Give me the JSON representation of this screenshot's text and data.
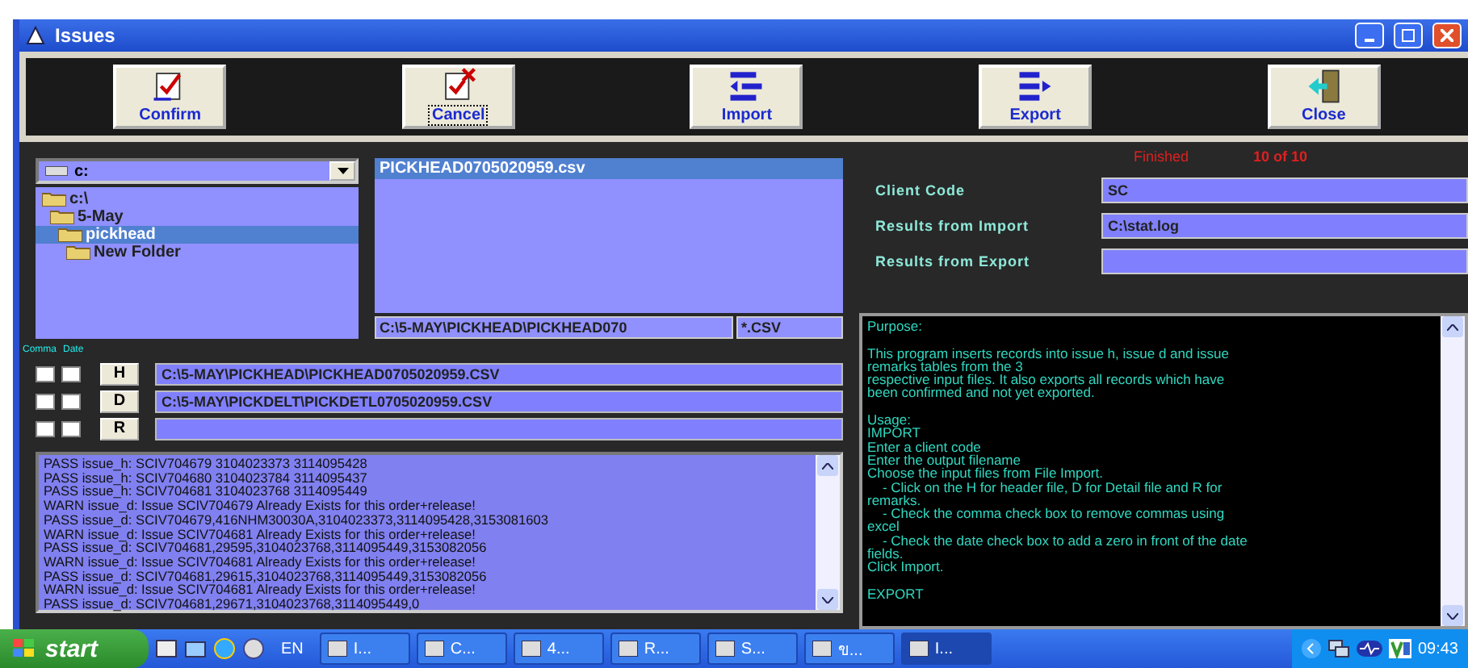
{
  "window": {
    "title": "Issues"
  },
  "toolbar": [
    {
      "kind": "confirm",
      "label": "Confirm",
      "focused": false
    },
    {
      "kind": "cancel",
      "label": "Cancel",
      "focused": true
    },
    {
      "kind": "import",
      "label": "Import",
      "focused": false
    },
    {
      "kind": "export",
      "label": "Export",
      "focused": false
    },
    {
      "kind": "close",
      "label": "Close",
      "focused": false
    }
  ],
  "status": {
    "message": "Finished",
    "progress": "10 of 10"
  },
  "drive": {
    "value": "c:"
  },
  "folders": [
    {
      "name": "c:\\",
      "selected": false,
      "children": [
        {
          "name": "5-May",
          "selected": false,
          "children": [
            {
              "name": "pickhead",
              "selected": true,
              "children": [
                {
                  "name": "New Folder",
                  "selected": false
                }
              ]
            }
          ]
        }
      ]
    }
  ],
  "files": [
    {
      "name": "PICKHEAD0705020959.csv",
      "selected": true
    }
  ],
  "path": {
    "value": "C:\\5-MAY\\PICKHEAD\\PICKHEAD070",
    "filter": "*.CSV"
  },
  "checkbox_headers": [
    "Comma",
    "Date"
  ],
  "imports": [
    {
      "button": "H",
      "comma_checked": false,
      "date_checked": false,
      "value": "C:\\5-MAY\\PICKHEAD\\PICKHEAD0705020959.CSV"
    },
    {
      "button": "D",
      "comma_checked": false,
      "date_checked": false,
      "value": "C:\\5-MAY\\PICKDELT\\PICKDETL0705020959.CSV"
    },
    {
      "button": "R",
      "comma_checked": false,
      "date_checked": false
    }
  ],
  "form": [
    {
      "label": "Client Code",
      "value": "SC"
    },
    {
      "label": "Results from Import",
      "value": "C:\\stat.log"
    },
    {
      "label": "Results from Export"
    }
  ],
  "log": [
    "PASS issue_h: SCIV704679 3104023373 3114095428",
    "PASS issue_h: SCIV704680 3104023784 3114095437",
    "PASS issue_h: SCIV704681 3104023768 3114095449",
    "WARN issue_d: Issue SCIV704679 Already Exists for this order+release!",
    "PASS issue_d: SCIV704679,416NHM30030A,3104023373,3114095428,3153081603",
    "WARN issue_d: Issue SCIV704681 Already Exists for this order+release!",
    "PASS issue_d: SCIV704681,29595,3104023768,3114095449,3153082056",
    "WARN issue_d: Issue SCIV704681 Already Exists for this order+release!",
    "PASS issue_d: SCIV704681,29615,3104023768,3114095449,3153082056",
    "WARN issue_d: Issue SCIV704681 Already Exists for this order+release!",
    "PASS issue_d: SCIV704681,29671,3104023768,3114095449,0"
  ],
  "help": [
    [
      "Purpose:"
    ],
    [
      "This program inserts records into issue h, issue d and issue",
      "remarks tables from the 3",
      "respective input files. It also exports all records which have",
      "been confirmed and not yet exported."
    ],
    [
      "Usage:",
      "IMPORT",
      "Enter a client code",
      "Enter the output filename",
      "Choose the input files from File Import.",
      "    - Click on the H for header file, D for Detail file and R for",
      "remarks.",
      "    - Check the comma check box to remove commas using",
      "excel",
      "    - Check the date check box to add a zero in front of the date",
      "fields.",
      "Click Import."
    ],
    [
      "EXPORT"
    ]
  ],
  "taskbar": {
    "start": "start",
    "language": "EN",
    "clock": "09:43",
    "tasks": [
      {
        "label": "I...",
        "selected": false
      },
      {
        "label": "C...",
        "selected": false
      },
      {
        "label": "4...",
        "selected": false
      },
      {
        "label": "R...",
        "selected": false
      },
      {
        "label": "S...",
        "selected": false
      },
      {
        "label": "ข...",
        "selected": false
      },
      {
        "label": "I...",
        "selected": true
      }
    ]
  }
}
